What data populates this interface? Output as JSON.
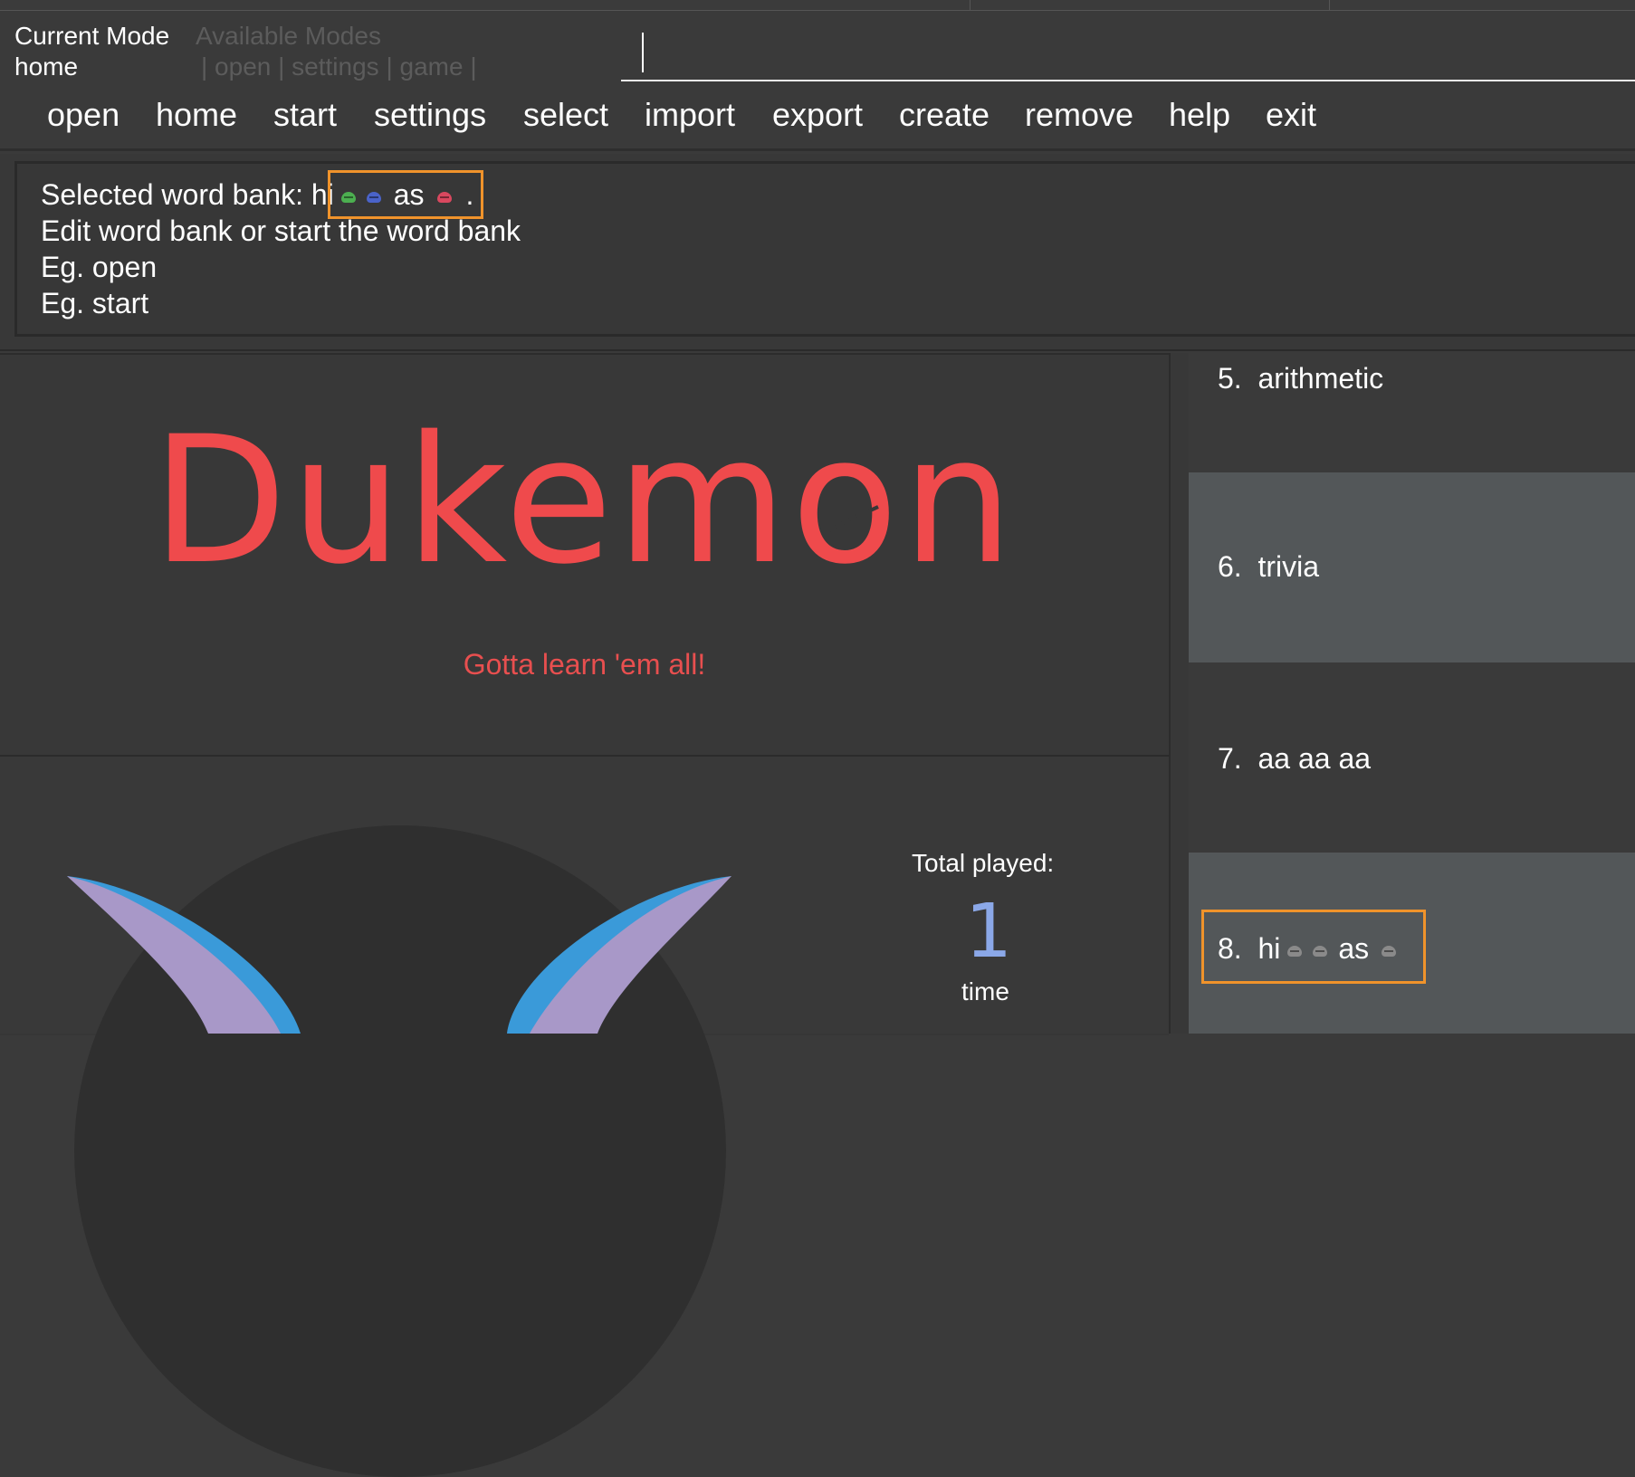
{
  "mode": {
    "current_label": "Current Mode",
    "current_value": "home",
    "available_label": "Available Modes",
    "available_value": "| open | settings | game |"
  },
  "command_input": {
    "value": "",
    "placeholder": ""
  },
  "menu": [
    "open",
    "home",
    "start",
    "settings",
    "select",
    "import",
    "export",
    "create",
    "remove",
    "help",
    "exit"
  ],
  "result": {
    "line1_prefix": "Selected word bank: hi",
    "line1_middle": "as",
    "line1_suffix": ".",
    "line2": "Edit word bank or start the word bank",
    "line3": "Eg. open",
    "line4": "Eg. start"
  },
  "app": {
    "title": "Dukemon",
    "tagline": "Gotta learn 'em all!"
  },
  "stats": {
    "total_label": "Total played:",
    "total_value": "1",
    "total_unit": "time"
  },
  "word_banks": [
    {
      "index": "5.",
      "name": "arithmetic"
    },
    {
      "index": "6.",
      "name": "trivia"
    },
    {
      "index": "7.",
      "name": "aa aa aa"
    },
    {
      "index": "8.",
      "name_prefix": "hi",
      "name_middle": "as"
    }
  ],
  "colors": {
    "background": "#3a3a3a",
    "accent_red": "#ef4a4c",
    "highlight_orange": "#f0932b",
    "stat_blue": "#8ba8e8",
    "row_alt": "#535759",
    "face_green": "#4caf50",
    "face_blue": "#4a63c9",
    "face_red": "#d9485f",
    "face_grey": "#8a8a8a",
    "horn_purple": "#a898c8",
    "horn_blue": "#3a9ad9"
  }
}
